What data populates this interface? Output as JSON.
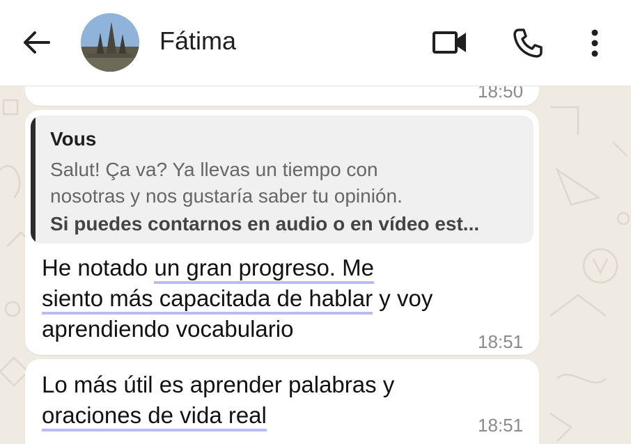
{
  "header": {
    "contact_name": "Fátima"
  },
  "messages": {
    "prev_time": "18:50",
    "quote": {
      "author": "Vous",
      "line1": "Salut! Ça va? Ya llevas un tiempo con",
      "line2": "nosotras y nos gustaría saber tu opinión.",
      "line3": "Si puedes contarnos en audio o en vídeo est..."
    },
    "msg1": {
      "l1_plain": "He notado ",
      "l1_ul": "un gran progreso. Me",
      "l2_ul": "siento más capacitada de hablar",
      "l2_plain": " y voy",
      "l3": "aprendiendo vocabulario",
      "time": "18:51"
    },
    "msg2": {
      "l1": "Lo más útil es aprender palabras y",
      "l2_ul": "oraciones de vida real",
      "time": "18:51"
    }
  },
  "colors": {
    "header_bg": "#ffffff",
    "chat_bg": "#efeae2",
    "bubble_bg": "#ffffff",
    "quote_bg": "#f0f0f0",
    "highlight_underline": "#b8bdf5"
  }
}
